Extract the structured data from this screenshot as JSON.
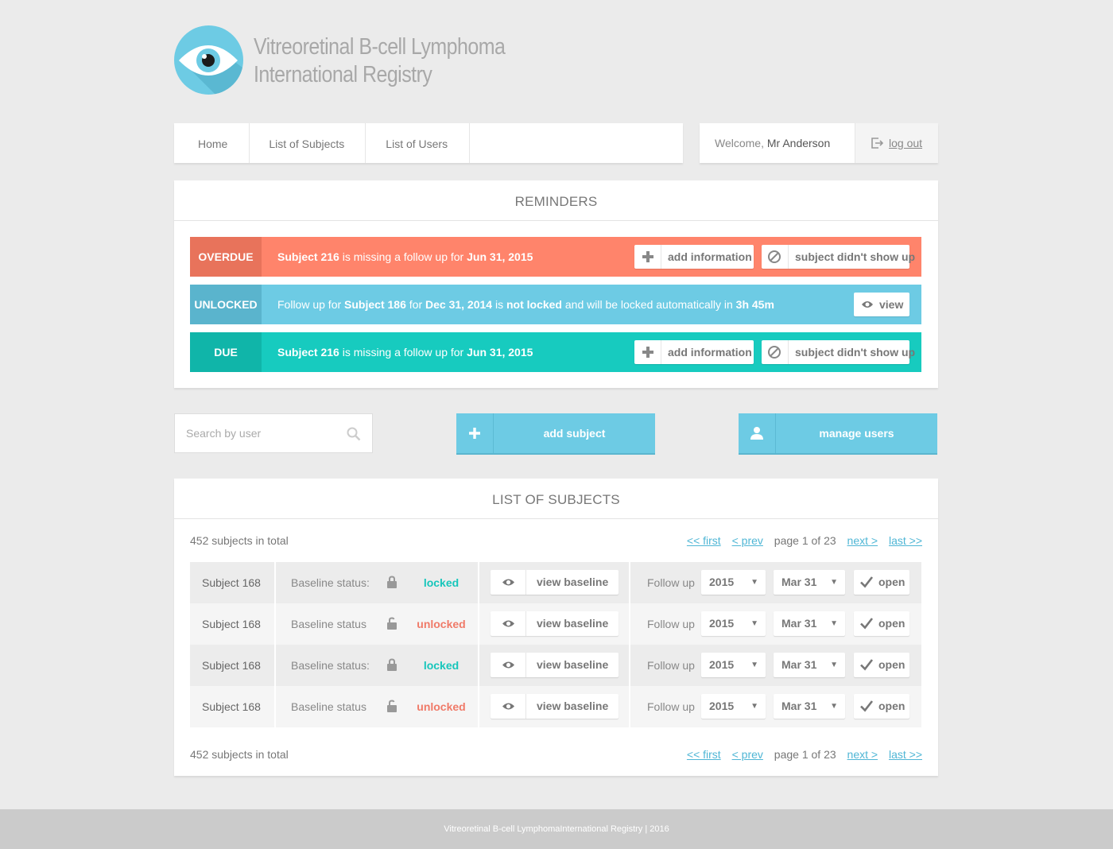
{
  "app": {
    "title_line1": "Vitreoretinal B-cell Lymphoma",
    "title_line2": "International Registry"
  },
  "nav": {
    "items": [
      {
        "label": "Home"
      },
      {
        "label": "List of Subjects"
      },
      {
        "label": "List of Users"
      }
    ]
  },
  "user": {
    "welcome": "Welcome,",
    "name": "Mr Anderson",
    "logout": "log out"
  },
  "reminders": {
    "title": "REMINDERS",
    "items": [
      {
        "tag": "OVERDUE",
        "subject": "Subject 216",
        "text1": " is missing a follow up for ",
        "date": "Jun 31, 2015",
        "btn_add": "add information",
        "btn_noshow": "subject didn't show up",
        "tag_color": "#e8735b",
        "bg_color": "#ff846b"
      },
      {
        "tag": "UNLOCKED",
        "prefix": "Follow up for ",
        "subject": "Subject 186",
        "mid1": " for ",
        "date": "Dec 31, 2014",
        "mid2": " is ",
        "not_locked": "not locked",
        "mid3": " and will be locked automatically in ",
        "time": "3h 45m",
        "btn_view": "view",
        "tag_color": "#5ab4cd",
        "bg_color": "#6dcbe4"
      },
      {
        "tag": "DUE",
        "subject": "Subject 216",
        "text1": " is missing a follow up for ",
        "date": "Jun 31, 2015",
        "btn_add": "add information",
        "btn_noshow": "subject didn't show up",
        "tag_color": "#10b5a9",
        "bg_color": "#17cbbf"
      }
    ]
  },
  "actions": {
    "search_placeholder": "Search by user",
    "add_subject": "add subject",
    "manage_users": "manage users"
  },
  "subjects": {
    "title": "LIST OF SUBJECTS",
    "total": "452 subjects in total",
    "pager": {
      "first": "<< first",
      "prev": "< prev",
      "page": "page 1 of 23",
      "next": "next >",
      "last": "last >>"
    },
    "rows": [
      {
        "subject": "Subject 168",
        "baseline_label": "Baseline status:",
        "status": "locked",
        "view": "view baseline",
        "followup": "Follow up",
        "year": "2015",
        "date": "Mar 31",
        "open": "open"
      },
      {
        "subject": "Subject 168",
        "baseline_label": "Baseline status",
        "status": "unlocked",
        "view": "view baseline",
        "followup": "Follow up",
        "year": "2015",
        "date": "Mar 31",
        "open": "open"
      },
      {
        "subject": "Subject 168",
        "baseline_label": "Baseline status:",
        "status": "locked",
        "view": "view baseline",
        "followup": "Follow up",
        "year": "2015",
        "date": "Mar 31",
        "open": "open"
      },
      {
        "subject": "Subject 168",
        "baseline_label": "Baseline status",
        "status": "unlocked",
        "view": "view baseline",
        "followup": "Follow up",
        "year": "2015",
        "date": "Mar 31",
        "open": "open"
      }
    ]
  },
  "footer": {
    "text": "Vitreoretinal B-cell LymphomaInternational Registry | 2016"
  }
}
